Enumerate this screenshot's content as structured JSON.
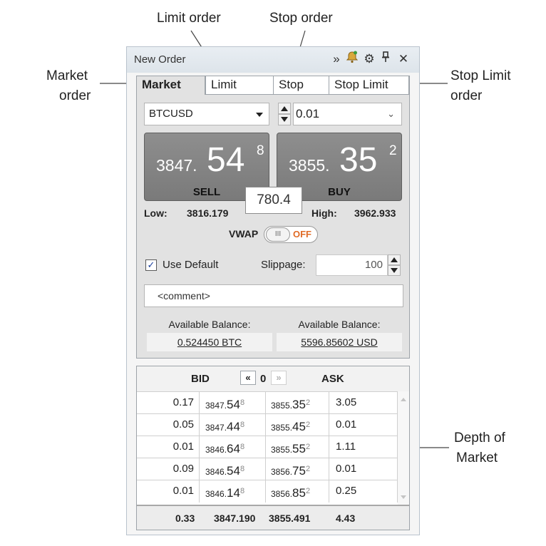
{
  "callouts": {
    "limit_order": "Limit order",
    "stop_order": "Stop order",
    "market_order_1": "Market",
    "market_order_2": "order",
    "stop_limit_order_1": "Stop Limit",
    "stop_limit_order_2": "order",
    "depth_1": "Depth of",
    "depth_2": "Market"
  },
  "window": {
    "title": "New Order",
    "icons": [
      "double-chevron-right-icon",
      "notification-bell-icon",
      "gear-icon",
      "pin-icon",
      "close-icon"
    ]
  },
  "tabs": [
    {
      "label": "Market",
      "active": true
    },
    {
      "label": "Limit",
      "active": false
    },
    {
      "label": "Stop",
      "active": false
    },
    {
      "label": "Stop Limit",
      "active": false
    }
  ],
  "symbol": {
    "value": "BTCUSD"
  },
  "quantity": {
    "value": "0.01"
  },
  "sell": {
    "small": "3847.",
    "big": "54",
    "sup": "8",
    "label": "SELL"
  },
  "buy": {
    "small": "3855.",
    "big": "35",
    "sup": "2",
    "label": "BUY"
  },
  "spread": "780.4",
  "low": {
    "label": "Low:",
    "value": "3816.179"
  },
  "high": {
    "label": "High:",
    "value": "3962.933"
  },
  "vwap": {
    "label": "VWAP",
    "knob": "III",
    "state": "OFF"
  },
  "use_default": {
    "label": "Use Default",
    "checked": true,
    "mark": "✓"
  },
  "slippage": {
    "label": "Slippage:",
    "value": "100"
  },
  "comment": {
    "value": "<comment>"
  },
  "balance": {
    "left_label": "Available Balance:",
    "left_value": "0.524450 BTC",
    "right_label": "Available Balance:",
    "right_value": "5596.85602 USD"
  },
  "depth": {
    "bid_header": "BID",
    "ask_header": "ASK",
    "prev": "«",
    "level": "0",
    "next": "»",
    "rows": [
      {
        "bid_vol": "0.17",
        "bid_s": "3847.",
        "bid_b": "54",
        "bid_u": "8",
        "ask_s": "3855.",
        "ask_b": "35",
        "ask_u": "2",
        "ask_vol": "3.05"
      },
      {
        "bid_vol": "0.05",
        "bid_s": "3847.",
        "bid_b": "44",
        "bid_u": "8",
        "ask_s": "3855.",
        "ask_b": "45",
        "ask_u": "2",
        "ask_vol": "0.01"
      },
      {
        "bid_vol": "0.01",
        "bid_s": "3846.",
        "bid_b": "64",
        "bid_u": "8",
        "ask_s": "3855.",
        "ask_b": "55",
        "ask_u": "2",
        "ask_vol": "1.11"
      },
      {
        "bid_vol": "0.09",
        "bid_s": "3846.",
        "bid_b": "54",
        "bid_u": "8",
        "ask_s": "3856.",
        "ask_b": "75",
        "ask_u": "2",
        "ask_vol": "0.01"
      },
      {
        "bid_vol": "0.01",
        "bid_s": "3846.",
        "bid_b": "14",
        "bid_u": "8",
        "ask_s": "3856.",
        "ask_b": "85",
        "ask_u": "2",
        "ask_vol": "0.25"
      }
    ],
    "totals": {
      "bid_vol": "0.33",
      "bid_avg": "3847.190",
      "ask_avg": "3855.491",
      "ask_vol": "4.43"
    }
  },
  "colors": {
    "off": "#e06b26",
    "price_button": "#8a8a8a",
    "check": "#1b3f9e"
  }
}
